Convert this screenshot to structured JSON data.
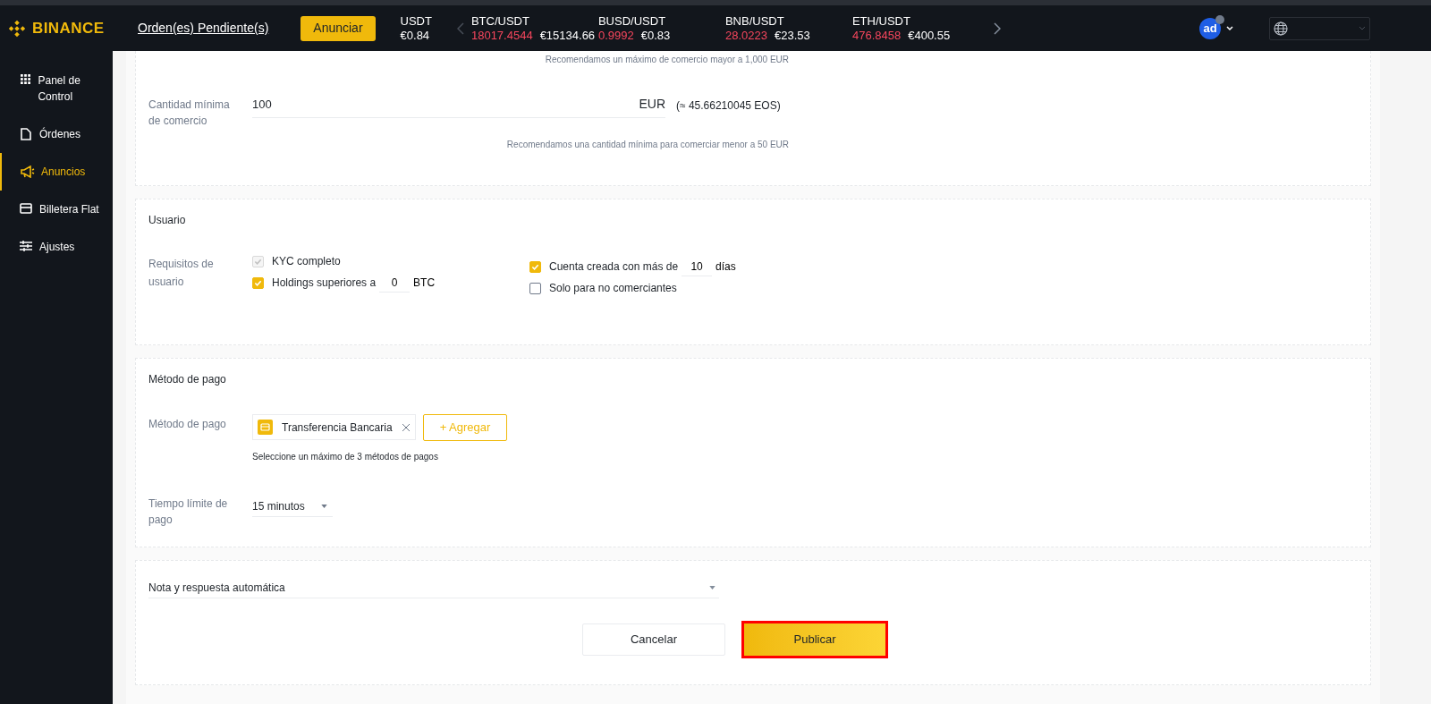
{
  "header": {
    "logo": "BINANCE",
    "pending_link": "Orden(es) Pendiente(s)",
    "announce_button": "Anunciar",
    "tickers": [
      {
        "pair": "USDT",
        "fiat": "€0.84"
      },
      {
        "pair": "BTC/USDT",
        "price": "18017.4544",
        "fiat": "€15134.66"
      },
      {
        "pair": "BUSD/USDT",
        "price": "0.9992",
        "fiat": "€0.83"
      },
      {
        "pair": "BNB/USDT",
        "price": "28.0223",
        "fiat": "€23.53"
      },
      {
        "pair": "ETH/USDT",
        "price": "476.8458",
        "fiat": "€400.55"
      }
    ],
    "avatar": "ad"
  },
  "sidebar": {
    "items": [
      {
        "label": "Panel de Control",
        "selected": false
      },
      {
        "label": "Órdenes",
        "selected": false
      },
      {
        "label": "Anuncios",
        "selected": true
      },
      {
        "label": "Billetera Flat",
        "selected": false
      },
      {
        "label": "Ajustes",
        "selected": false
      }
    ]
  },
  "amount_section": {
    "max_hint": "Recomendamos un máximo de comercio mayor a 1,000 EUR",
    "min_label": "Cantidad mínima de comercio",
    "min_value": "100",
    "min_currency": "EUR",
    "min_conversion": "(≈ 45.66210045 EOS)",
    "min_hint": "Recomendamos una cantidad mínima para comerciar menor a 50 EUR"
  },
  "user_section": {
    "title": "Usuario",
    "label": "Requisitos de usuario",
    "requirements": [
      [
        {
          "label": "KYC completo",
          "checked": true,
          "disabled": true
        },
        {
          "label": "Holdings superiores a",
          "checked": true,
          "disabled": false,
          "value": "0",
          "suffix": "BTC"
        }
      ],
      [
        {
          "label": "Cuenta creada con más de",
          "checked": true,
          "disabled": false,
          "value": "10",
          "suffix": "días"
        },
        {
          "label": "Solo para no comerciantes",
          "checked": false,
          "disabled": false
        }
      ]
    ]
  },
  "payment_section": {
    "title": "Método de pago",
    "method_label": "Método de pago",
    "methods": [
      "Transferencia Bancaria"
    ],
    "add_button": "+ Agregar",
    "hint": "Seleccione un máximo de 3 métodos de pagos",
    "time_label": "Tiempo límite de pago",
    "time_value": "15 minutos"
  },
  "note_section": {
    "title": "Nota y respuesta automática",
    "expanded": false,
    "cancel_button": "Cancelar",
    "publish_button": "Publicar"
  }
}
